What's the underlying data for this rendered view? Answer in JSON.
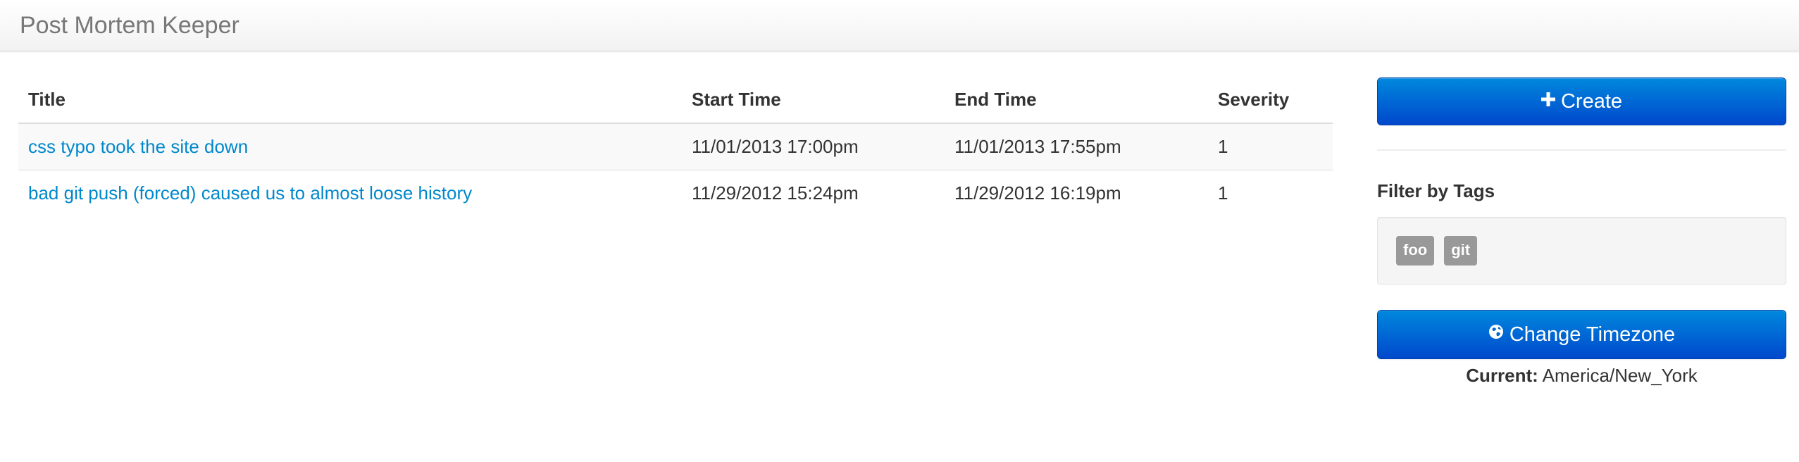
{
  "app": {
    "brand": "Post Mortem Keeper"
  },
  "table": {
    "headers": {
      "title": "Title",
      "start": "Start Time",
      "end": "End Time",
      "severity": "Severity"
    },
    "rows": [
      {
        "title": "css typo took the site down",
        "start": "11/01/2013 17:00pm",
        "end": "11/01/2013 17:55pm",
        "severity": "1"
      },
      {
        "title": "bad git push (forced) caused us to almost loose history",
        "start": "11/29/2012 15:24pm",
        "end": "11/29/2012 16:19pm",
        "severity": "1"
      }
    ]
  },
  "sidebar": {
    "create_label": "Create",
    "filter_heading": "Filter by Tags",
    "tags": [
      "foo",
      "git"
    ],
    "timezone_button_label": "Change Timezone",
    "current_label": "Current:",
    "current_value": "America/New_York"
  },
  "colors": {
    "link": "#0088cc",
    "primary_button": "#0066cc",
    "tag": "#999999"
  },
  "icons": {
    "create": "plus-icon",
    "timezone": "globe-icon"
  }
}
